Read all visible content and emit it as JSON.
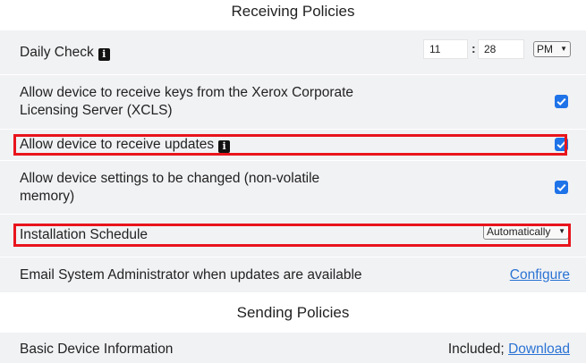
{
  "receiving_section": {
    "title": "Receiving Policies"
  },
  "daily_check": {
    "label": "Daily Check",
    "info_glyph": "i",
    "hour": "11",
    "separator": ":",
    "minute": "28",
    "ampm": "PM"
  },
  "xcls_keys": {
    "label_line1": "Allow device to receive keys from the Xerox Corporate",
    "label_line2": "Licensing Server (XCLS)",
    "checked": true
  },
  "receive_updates": {
    "label": "Allow device to receive updates",
    "info_glyph": "i",
    "checked": true
  },
  "settings_change": {
    "label_line1": "Allow device settings to be changed (non-volatile",
    "label_line2": "memory)",
    "checked": true
  },
  "installation_schedule": {
    "label": "Installation Schedule",
    "selected": "Automatically"
  },
  "email_admin": {
    "label": "Email System Administrator when updates are available",
    "link": "Configure"
  },
  "sending_section": {
    "title": "Sending Policies"
  },
  "basic_info": {
    "label": "Basic Device Information",
    "status": "Included;",
    "link": "Download"
  },
  "colors": {
    "row_background": "#f1f2f4",
    "checkbox_blue": "#1e73e8",
    "link_blue": "#2a73d4",
    "highlight_red": "#e8141c"
  },
  "icons": {
    "info": "info-icon",
    "checkbox": "checkmark-icon",
    "dropdown": "chevron-down-icon"
  }
}
